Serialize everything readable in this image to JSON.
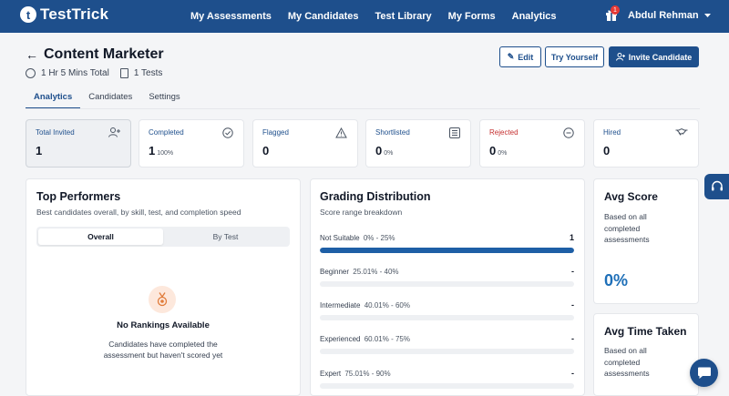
{
  "brand": {
    "name": "TestTrick",
    "mark": "t"
  },
  "nav": {
    "links": [
      "My Assessments",
      "My Candidates",
      "Test Library",
      "My Forms",
      "Analytics"
    ],
    "gift_badge": "1",
    "user_name": "Abdul Rehman"
  },
  "header": {
    "title": "Content Marketer",
    "duration": "1 Hr 5 Mins Total",
    "tests": "1 Tests",
    "edit_label": "Edit",
    "try_label": "Try Yourself",
    "invite_label": "Invite Candidate"
  },
  "tabs": [
    "Analytics",
    "Candidates",
    "Settings"
  ],
  "stats": [
    {
      "label": "Total Invited",
      "value": "1",
      "pct": "",
      "icon": "add-user-icon"
    },
    {
      "label": "Completed",
      "value": "1",
      "pct": "100%",
      "icon": "check-circle-icon"
    },
    {
      "label": "Flagged",
      "value": "0",
      "pct": "",
      "icon": "warning-icon"
    },
    {
      "label": "Shortlisted",
      "value": "0",
      "pct": "0%",
      "icon": "list-icon"
    },
    {
      "label": "Rejected",
      "value": "0",
      "pct": "0%",
      "icon": "minus-circle-icon"
    },
    {
      "label": "Hired",
      "value": "0",
      "pct": "",
      "icon": "handshake-icon"
    }
  ],
  "top_performers": {
    "title": "Top Performers",
    "subtitle": "Best candidates overall, by skill, test, and completion speed",
    "seg_overall": "Overall",
    "seg_bytest": "By Test",
    "empty_title": "No Rankings Available",
    "empty_text": "Candidates have completed the assessment but haven't scored yet"
  },
  "grading": {
    "title": "Grading Distribution",
    "subtitle": "Score range breakdown",
    "rows": [
      {
        "name": "Not Suitable",
        "range": "0% - 25%",
        "count": "1",
        "fill": 1.0
      },
      {
        "name": "Beginner",
        "range": "25.01% - 40%",
        "count": "-",
        "fill": 0
      },
      {
        "name": "Intermediate",
        "range": "40.01% - 60%",
        "count": "-",
        "fill": 0
      },
      {
        "name": "Experienced",
        "range": "60.01% - 75%",
        "count": "-",
        "fill": 0
      },
      {
        "name": "Expert",
        "range": "75.01% - 90%",
        "count": "-",
        "fill": 0
      }
    ]
  },
  "avg_score": {
    "title": "Avg Score",
    "text": "Based on all completed assessments",
    "value": "0%"
  },
  "avg_time": {
    "title": "Avg Time Taken",
    "text": "Based on all completed assessments"
  },
  "colors": {
    "brand": "#1e4f8c",
    "accent": "#1e6fb8",
    "danger": "#c53030"
  }
}
